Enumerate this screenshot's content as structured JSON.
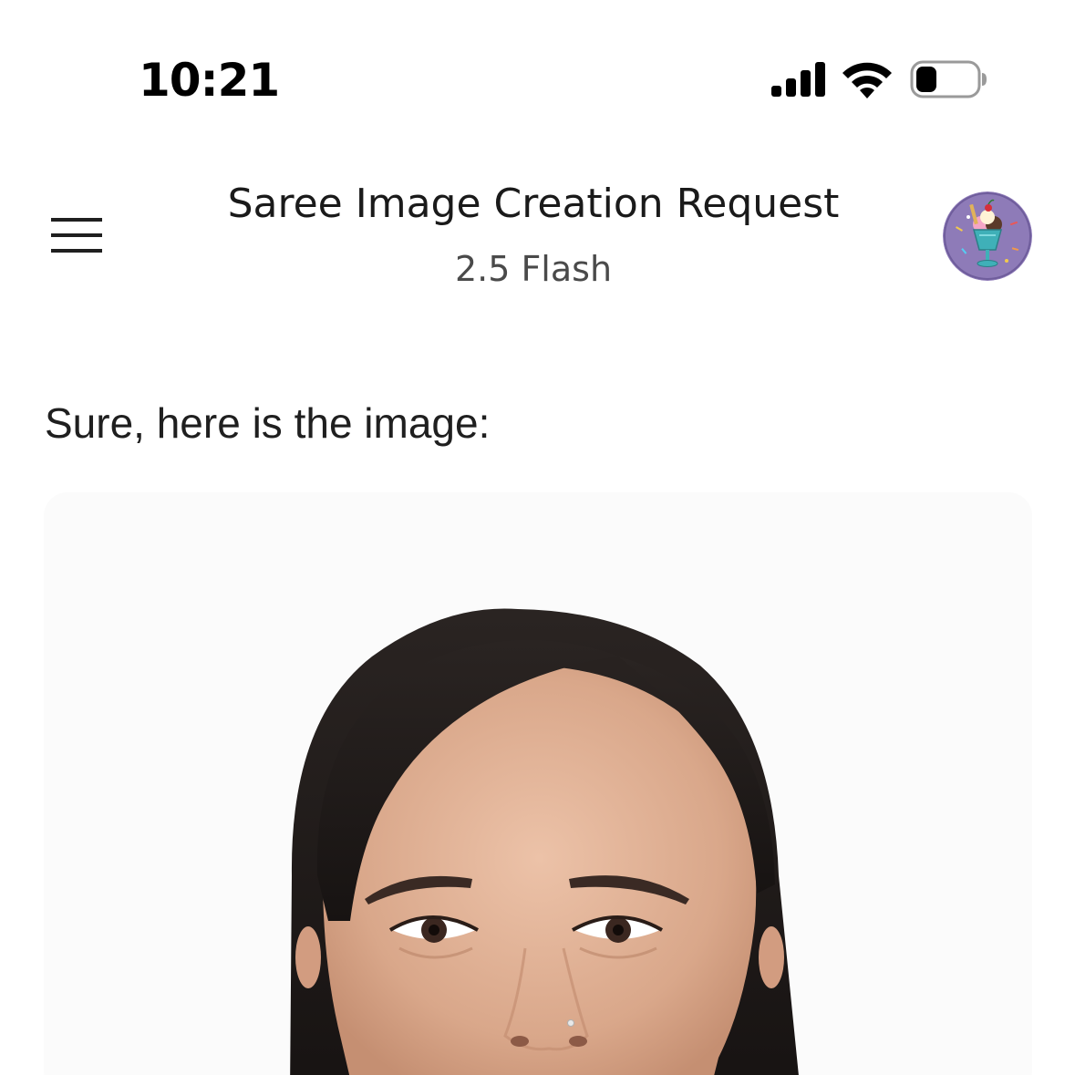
{
  "status_bar": {
    "time": "10:21",
    "signal_icon": "cellular-signal-icon",
    "wifi_icon": "wifi-icon",
    "battery_icon": "battery-low-icon"
  },
  "header": {
    "menu_icon": "hamburger-menu-icon",
    "title": "Saree Image Creation Request",
    "subtitle": "2.5 Flash",
    "avatar_icon": "sundae-avatar"
  },
  "conversation": {
    "response_text": "Sure, here is the image:",
    "image_subject": "generated portrait photo"
  },
  "colors": {
    "background": "#ffffff",
    "text_primary": "#1f1f1f",
    "text_secondary": "#4a4a4a",
    "avatar_bg": "#8e7bb8"
  }
}
